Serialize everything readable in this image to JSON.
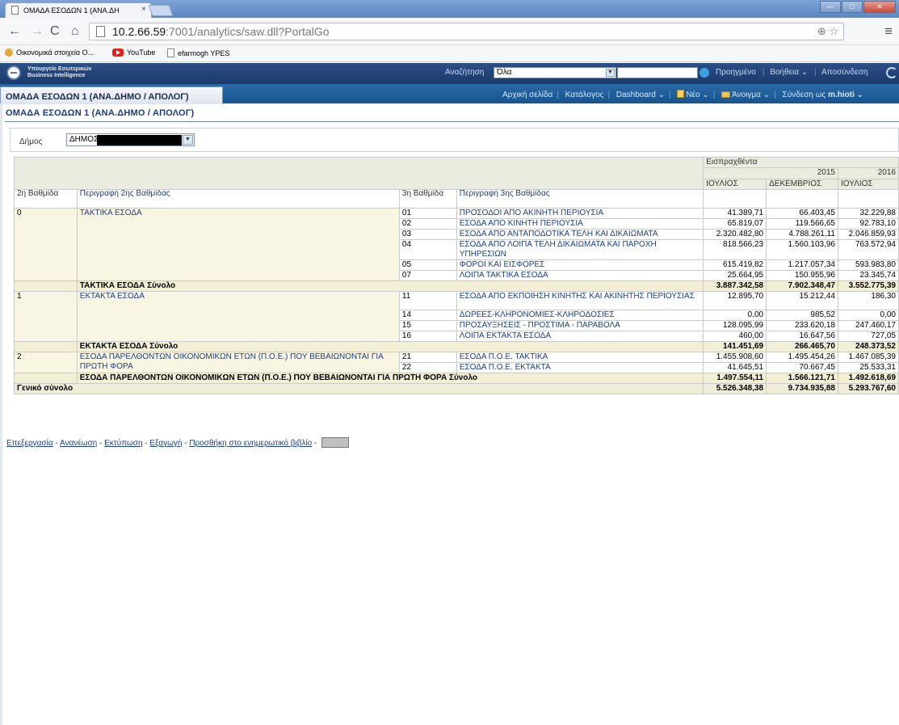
{
  "browser": {
    "tab_title": "ΟΜΑΔΑ ΕΣΟΔΩΝ 1 (ΑΝΑ.ΔΗ",
    "tab_close": "×",
    "url_host": "10.2.66.59",
    "url_rest": ":7001/analytics/saw.dll?PortalGo",
    "bookmarks": [
      "Οικονομικά στοιχεία Ο...",
      "YouTube",
      "efarmogh YPES"
    ]
  },
  "obi_header": {
    "logo_line1": "Υπουργείο Εσωτερικών",
    "logo_line2": "Business Intelligence",
    "search_label": "Αναζήτηση",
    "search_scope": "Όλα",
    "advanced": "Προηγμένο",
    "help": "Βοήθεια ⌄",
    "signout": "Αποσύνδεση"
  },
  "obi_bar2": {
    "dashboard_title": "ΟΜΑΔΑ ΕΣΟΔΩΝ 1 (ΑΝΑ.ΔΗΜΟ / ΑΠΟΛΟΓ)",
    "home": "Αρχική σελίδα",
    "catalog": "Κατάλογος",
    "dashboard": "Dashboard ⌄",
    "new": "Νέο ⌄",
    "open": "Άνοιγμα ⌄",
    "signed_in": "Σύνδεση ως",
    "user": "m.hioti ⌄"
  },
  "page": {
    "heading": "ΟΜΑΔΑ ΕΣΟΔΩΝ 1 (ΑΝΑ.ΔΗΜΟ / ΑΠΟΛΟΓ)",
    "prompt_label": "Δήμος",
    "prompt_value": "ΔΗΜΟΣ"
  },
  "table": {
    "measure": "Εισπραχθέντα",
    "year_2015": "2015",
    "year_2016": "2016",
    "month_jul": "ΙΟΥΛΙΟΣ",
    "month_dec": "ΔΕΚΕΜΒΡΙΟΣ",
    "month_jul2": "ΙΟΥΛΙΟΣ",
    "col_level2": "2η Βαθμίδα",
    "col_desc2": "Περιγραφή 2ης Βαθμίδας",
    "col_level3": "3η Βαθμίδα",
    "col_desc3": "Περιγραφή 3ης Βαθμίδας",
    "groups": [
      {
        "code": "0",
        "name": "ΤΑΚΤΙΚΑ ΕΣΟΔΑ",
        "rows": [
          {
            "code": "01",
            "desc": "ΠΡΟΣΟΔΟΙ ΑΠΟ ΑΚΙΝΗΤΗ ΠΕΡΙΟΥΣΙΑ",
            "v1": "41.389,71",
            "v2": "66.403,45",
            "v3": "32.229,88"
          },
          {
            "code": "02",
            "desc": "ΕΣΟΔΑ ΑΠΟ ΚΙΝΗΤΗ ΠΕΡΙΟΥΣΙΑ",
            "v1": "65.819,07",
            "v2": "119.566,65",
            "v3": "92.783,10"
          },
          {
            "code": "03",
            "desc": "ΕΣΟΔΑ ΑΠΟ ΑΝΤΑΠΟΔΟΤΙΚΑ ΤΕΛΗ ΚΑΙ ΔΙΚΑΙΩΜΑΤΑ",
            "v1": "2.320.482,80",
            "v2": "4.788.261,11",
            "v3": "2.046.859,93"
          },
          {
            "code": "04",
            "desc": "ΕΣΟΔΑ ΑΠΟ ΛΟΙΠΑ ΤΕΛΗ ΔΙΚΑΙΩΜΑΤΑ ΚΑΙ ΠΑΡΟΧΗ ΥΠΗΡΕΣΙΩΝ",
            "v1": "818.566,23",
            "v2": "1.560.103,96",
            "v3": "763.572,94"
          },
          {
            "code": "05",
            "desc": "ΦΟΡΟΙ ΚΑΙ ΕΙΣΦΟΡΕΣ",
            "v1": "615.419,82",
            "v2": "1.217.057,34",
            "v3": "593.983,80"
          },
          {
            "code": "07",
            "desc": "ΛΟΙΠΑ ΤΑΚΤΙΚΑ ΕΣΟΔΑ",
            "v1": "25.664,95",
            "v2": "150.955,96",
            "v3": "23.345,74"
          }
        ],
        "subtotal_label": "ΤΑΚΤΙΚΑ ΕΣΟΔΑ Σύνολο",
        "subtotal": [
          "3.887.342,58",
          "7.902.348,47",
          "3.552.775,39"
        ]
      },
      {
        "code": "1",
        "name": "ΕΚΤΑΚΤΑ ΕΣΟΔΑ",
        "rows": [
          {
            "code": "11",
            "desc": "ΕΣΟΔΑ ΑΠΟ ΕΚΠΟΙΗΣΗ ΚΙΝΗΤΗΣ ΚΑΙ ΑΚΙΝΗΤΗΣ ΠΕΡΙΟΥΣΙΑΣ",
            "v1": "12.895,70",
            "v2": "15.212,44",
            "v3": "186,30"
          },
          {
            "code": "14",
            "desc": "ΔΩΡΕΕΣ-ΚΛΗΡΟΝΟΜΙΕΣ-ΚΛΗΡΟΔΟΣΙΕΣ",
            "v1": "0,00",
            "v2": "985,52",
            "v3": "0,00"
          },
          {
            "code": "15",
            "desc": "ΠΡΟΣΑΥΞΗΣΕΙΣ - ΠΡΟΣΤΙΜΑ - ΠΑΡΑΒΟΛΑ",
            "v1": "128.095,99",
            "v2": "233.620,18",
            "v3": "247.460,17"
          },
          {
            "code": "16",
            "desc": "ΛΟΙΠΑ ΕΚΤΑΚΤΑ ΕΣΟΔΑ",
            "v1": "460,00",
            "v2": "16.647,56",
            "v3": "727,05"
          }
        ],
        "subtotal_label": "ΕΚΤΑΚΤΑ ΕΣΟΔΑ Σύνολο",
        "subtotal": [
          "141.451,69",
          "266.465,70",
          "248.373,52"
        ]
      },
      {
        "code": "2",
        "name": "ΕΣΟΔΑ ΠΑΡΕΛΘΟΝΤΩΝ ΟΙΚΟΝΟΜΙΚΩΝ ΕΤΩΝ (Π.Ο.Ε.) ΠΟΥ ΒΕΒΑΙΩΝΟΝΤΑΙ ΓΙΑ ΠΡΩΤΗ ΦΟΡΑ",
        "rows": [
          {
            "code": "21",
            "desc": "ΕΣΟΔΑ Π.Ο.Ε. ΤΑΚΤΙΚΑ",
            "v1": "1.455.908,60",
            "v2": "1.495.454,26",
            "v3": "1.467.085,39"
          },
          {
            "code": "22",
            "desc": "ΕΣΟΔΑ Π.Ο.Ε. ΕΚΤΑΚΤΑ",
            "v1": "41.645,51",
            "v2": "70.667,45",
            "v3": "25.533,31"
          }
        ],
        "subtotal_label": "ΕΣΟΔΑ ΠΑΡΕΛΘΟΝΤΩΝ ΟΙΚΟΝΟΜΙΚΩΝ ΕΤΩΝ (Π.Ο.Ε.) ΠΟΥ ΒΕΒΑΙΩΝΟΝΤΑΙ ΓΙΑ ΠΡΩΤΗ ΦΟΡΑ Σύνολο",
        "subtotal": [
          "1.497.554,11",
          "1.566.121,71",
          "1.492.618,69"
        ]
      }
    ],
    "grand_label": "Γενικό σύνολο",
    "grand": [
      "5.526.348,38",
      "9.734.935,88",
      "5.293.767,60"
    ]
  },
  "footer": {
    "links": [
      "Επεξεργασία",
      "Ανανέωση",
      "Εκτύπωση",
      "Εξαγωγή",
      "Προσθήκη στο ενημερωτικό βιβλίο"
    ],
    "sep": " - "
  }
}
